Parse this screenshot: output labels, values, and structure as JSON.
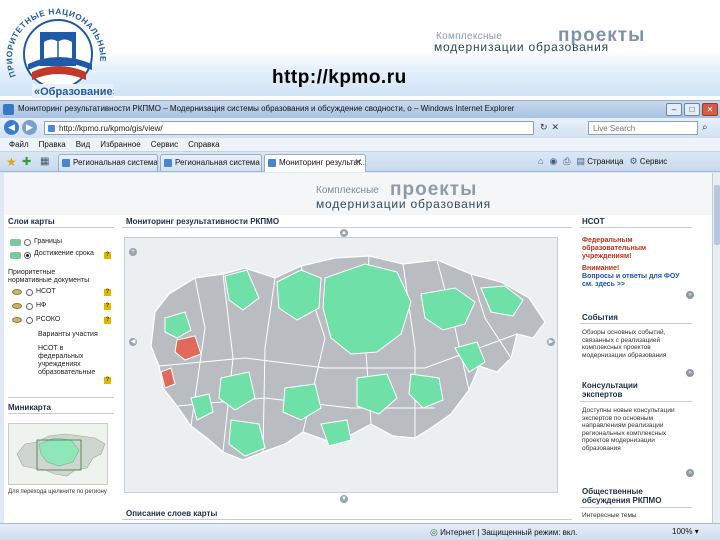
{
  "slide": {
    "logo_text_arc": "ПРИОРИТЕТНЫЕ НАЦИОНАЛЬНЫЕ ПРОЕКТЫ",
    "logo_text_bottom": "«Образование»",
    "brand_small": "Комплексные",
    "brand_big": "проекты",
    "brand_sub": "модернизации образования",
    "url": "http://kpmo.ru"
  },
  "browser": {
    "title": "Мониторинг результативности РКПМО – Модернизация системы образования и обсуждение сводности, о – Windows Internet Explorer",
    "address": "http://kpmo.ru/kpmo/gis/view/",
    "search_placeholder": "Live Search",
    "menu": [
      "Файл",
      "Правка",
      "Вид",
      "Избранное",
      "Сервис",
      "Справка"
    ],
    "tabs": [
      {
        "label": "Региональная система о..."
      },
      {
        "label": "Региональная система об..."
      },
      {
        "label": "Мониторинг результат..."
      }
    ],
    "commands": [
      "Страница",
      "Сервис"
    ],
    "status": {
      "zone": "Интернет | Защищенный режим: вкл.",
      "zoom": "100%"
    },
    "window_buttons": {
      "minimize": "–",
      "maximize": "□",
      "close": "✕"
    }
  },
  "site": {
    "brand_small": "Комплексные",
    "brand_big": "проекты",
    "brand_sub": "модернизации образования",
    "left": {
      "title": "Слои карты",
      "layers": [
        {
          "label": "Границы"
        },
        {
          "label": "Достижение срока"
        },
        {
          "label": "Приоритетные нормативные документы"
        },
        {
          "label": "НСОТ"
        },
        {
          "label": "НФ"
        },
        {
          "label": "РСОКО"
        },
        {
          "label": "Варианты участия"
        },
        {
          "label": "НСОТ в федеральных учреждениях образовательные"
        }
      ],
      "minimap_title": "Миникарта",
      "minimap_note": "Для перехода щелкните по региону"
    },
    "center": {
      "title": "Мониторинг результативности РКПМО",
      "bottom_title": "Описание слоев карты"
    },
    "right": {
      "title1": "НСОТ",
      "red1": "Федеральным образовательным учреждениям!",
      "red2": "Внимание!",
      "blue1": "Вопросы и ответы для ФОУ см. здесь >>",
      "title2": "События",
      "events_text": "Обзоры основных событий, связанных с реализацией комплексных проектов модернизации образования",
      "title3": "Консультации экспертов",
      "consult_text": "Доступны новые консультации экспертов по основным направлениям реализации региональных комплексных проектов модернизации образования",
      "title4": "Общественные обсуждения РКПМО",
      "more_text": "Интересные темы"
    }
  },
  "colors": {
    "region_green": "#6ee0a8",
    "region_gray": "#b9bdc2",
    "region_red": "#e06a5c",
    "header_band": "#cfe4f7"
  }
}
